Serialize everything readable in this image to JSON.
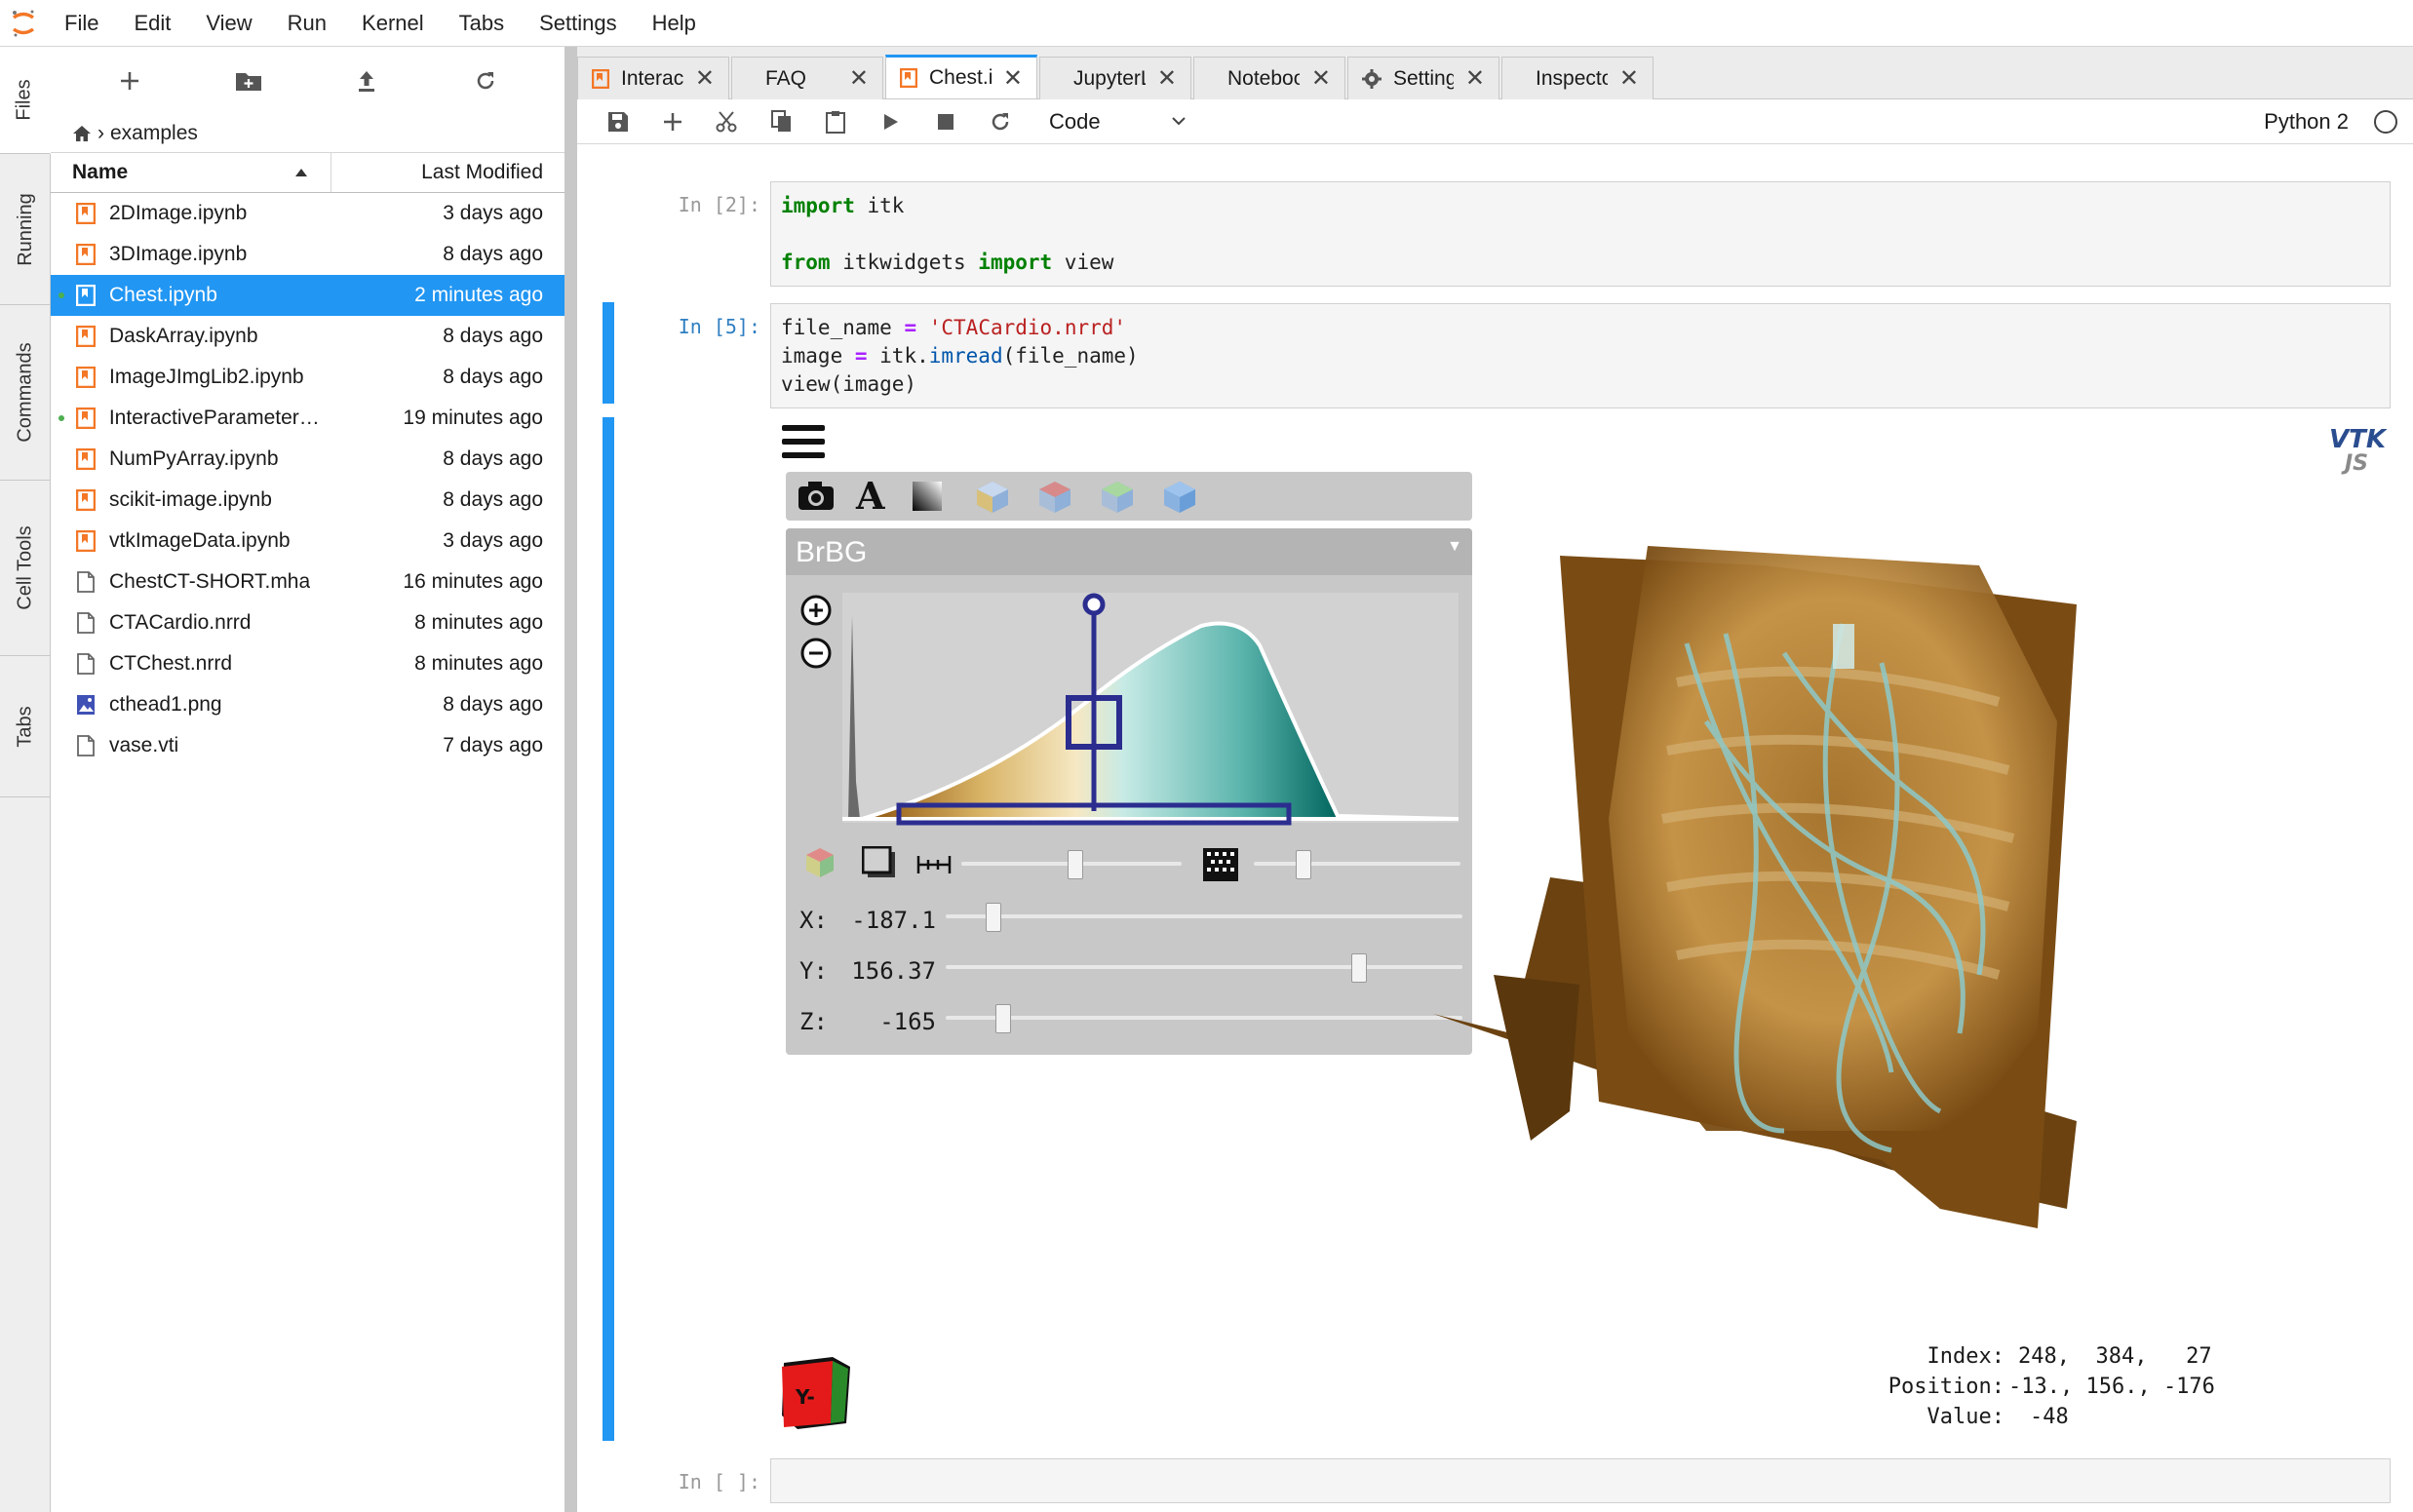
{
  "menubar": {
    "items": [
      "File",
      "Edit",
      "View",
      "Run",
      "Kernel",
      "Tabs",
      "Settings",
      "Help"
    ]
  },
  "activitybar": {
    "tabs": [
      "Files",
      "Running",
      "Commands",
      "Cell Tools",
      "Tabs"
    ]
  },
  "filebrowser": {
    "breadcrumb": "examples",
    "columns": {
      "name": "Name",
      "modified": "Last Modified"
    },
    "files": [
      {
        "name": "2DImage.ipynb",
        "modified": "3 days ago",
        "type": "notebook"
      },
      {
        "name": "3DImage.ipynb",
        "modified": "8 days ago",
        "type": "notebook"
      },
      {
        "name": "Chest.ipynb",
        "modified": "2 minutes ago",
        "type": "notebook"
      },
      {
        "name": "DaskArray.ipynb",
        "modified": "8 days ago",
        "type": "notebook"
      },
      {
        "name": "ImageJImgLib2.ipynb",
        "modified": "8 days ago",
        "type": "notebook"
      },
      {
        "name": "InteractiveParameterE…",
        "modified": "19 minutes ago",
        "type": "notebook"
      },
      {
        "name": "NumPyArray.ipynb",
        "modified": "8 days ago",
        "type": "notebook"
      },
      {
        "name": "scikit-image.ipynb",
        "modified": "8 days ago",
        "type": "notebook"
      },
      {
        "name": "vtkImageData.ipynb",
        "modified": "3 days ago",
        "type": "notebook"
      },
      {
        "name": "ChestCT-SHORT.mha",
        "modified": "16 minutes ago",
        "type": "file"
      },
      {
        "name": "CTACardio.nrrd",
        "modified": "8 minutes ago",
        "type": "file"
      },
      {
        "name": "CTChest.nrrd",
        "modified": "8 minutes ago",
        "type": "file"
      },
      {
        "name": "cthead1.png",
        "modified": "8 days ago",
        "type": "image"
      },
      {
        "name": "vase.vti",
        "modified": "7 days ago",
        "type": "file"
      }
    ]
  },
  "tabs": [
    {
      "label": "InteractivePara",
      "icon": "notebook"
    },
    {
      "label": "FAQ",
      "icon": "none"
    },
    {
      "label": "Chest.ipynb",
      "icon": "notebook",
      "active": true
    },
    {
      "label": "JupyterLab Ref",
      "icon": "none"
    },
    {
      "label": "Notebook Refe",
      "icon": "none"
    },
    {
      "label": "Settings",
      "icon": "gear"
    },
    {
      "label": "Inspector",
      "icon": "none"
    }
  ],
  "toolbar": {
    "cell_type": "Code",
    "kernel": "Python 2"
  },
  "cells": {
    "c1_prompt": "In [2]:",
    "c2_prompt": "In [5]:",
    "c3_prompt": "In [ ]:"
  },
  "viewer": {
    "colormap": "BrBG",
    "x_label": "X:",
    "x_value": "-187.1",
    "x_slider": 0.08,
    "y_label": "Y:",
    "y_value": "156.37",
    "y_slider": 0.81,
    "z_label": "Z:",
    "z_value": "-165",
    "z_slider": 0.1,
    "index_label": "Index:",
    "index_value": "248,  384,   27",
    "position_label": "Position:",
    "position_value": "-13., 156., -176",
    "value_label": "Value:",
    "value_value": "-48",
    "orientation_label": "Y-",
    "vtk_logo": "VTK",
    "vtk_logo_sub": "JS",
    "colors": {
      "accent": "#2196f3",
      "volume": "#6b4210",
      "handle": "#2b2d8f"
    }
  }
}
